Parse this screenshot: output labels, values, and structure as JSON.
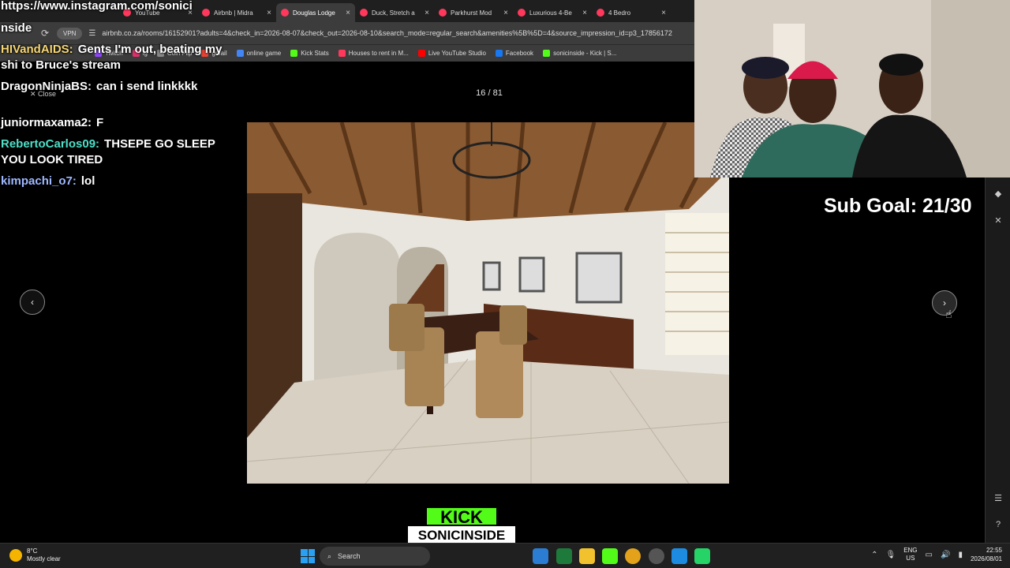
{
  "browser": {
    "tabs": [
      {
        "label": "YouTube",
        "active": false
      },
      {
        "label": "Airbnb | Midra",
        "active": false
      },
      {
        "label": "Douglas Lodge",
        "active": true
      },
      {
        "label": "Duck, Stretch a",
        "active": false
      },
      {
        "label": "Parkhurst Mod",
        "active": false
      },
      {
        "label": "Luxurious 4-Be",
        "active": false
      },
      {
        "label": "4 Bedro",
        "active": false
      }
    ],
    "vpn_label": "VPN",
    "url": "airbnb.co.za/rooms/16152901?adults=4&check_in=2026-08-07&check_out=2026-08-10&search_mode=regular_search&amenities%5B%5D=4&source_impression_id=p3_17856172",
    "bookmarks": [
      {
        "label": "Twitch",
        "color": "#9146ff"
      },
      {
        "label": "ig",
        "color": "#e1306c"
      },
      {
        "label": "Coin Flip",
        "color": "#888888"
      },
      {
        "label": "gmail",
        "color": "#ea4335"
      },
      {
        "label": "online game",
        "color": "#4285f4"
      },
      {
        "label": "Kick Stats",
        "color": "#53fc18"
      },
      {
        "label": "Houses to rent in M...",
        "color": "#ff385c"
      },
      {
        "label": "Live YouTube Studio",
        "color": "#ff0000"
      },
      {
        "label": "Facebook",
        "color": "#1877f2"
      },
      {
        "label": "sonicinside - Kick | S...",
        "color": "#53fc18"
      }
    ]
  },
  "gallery": {
    "counter": "16 / 81",
    "close_label": "Close",
    "prev_icon": "chevron-left-icon",
    "next_icon": "chevron-right-icon"
  },
  "chat": {
    "header_line": "https://www.instagram.com/sonici",
    "header_line2": "nside",
    "messages": [
      {
        "user": "HIVandAIDS:",
        "text": "Gents I'm out, beating my shi to Bruce's stream",
        "color": "#f7d774"
      },
      {
        "user": "DragonNinjaBS:",
        "text": "can i send linkkkk",
        "color": "#ffffff"
      },
      {
        "user": "juniormaxama2:",
        "text": "F",
        "color": "#ffffff"
      },
      {
        "user": "RebertoCarlos09:",
        "text": "THSEPE GO SLEEP YOU LOOK TIRED",
        "color": "#4de0c8"
      },
      {
        "user": "kimpachi_o7:",
        "text": "lol",
        "color": "#9fb8ff"
      }
    ]
  },
  "overlay": {
    "sub_goal": "Sub Goal: 21/30",
    "kick_line1": "KICK",
    "kick_line2": "SONICINSIDE"
  },
  "taskbar": {
    "temperature": "8°C",
    "weather": "Mostly clear",
    "search_label": "Search",
    "lang_line1": "ENG",
    "lang_line2": "US",
    "time": "22:55",
    "date": "2026/08/01"
  }
}
